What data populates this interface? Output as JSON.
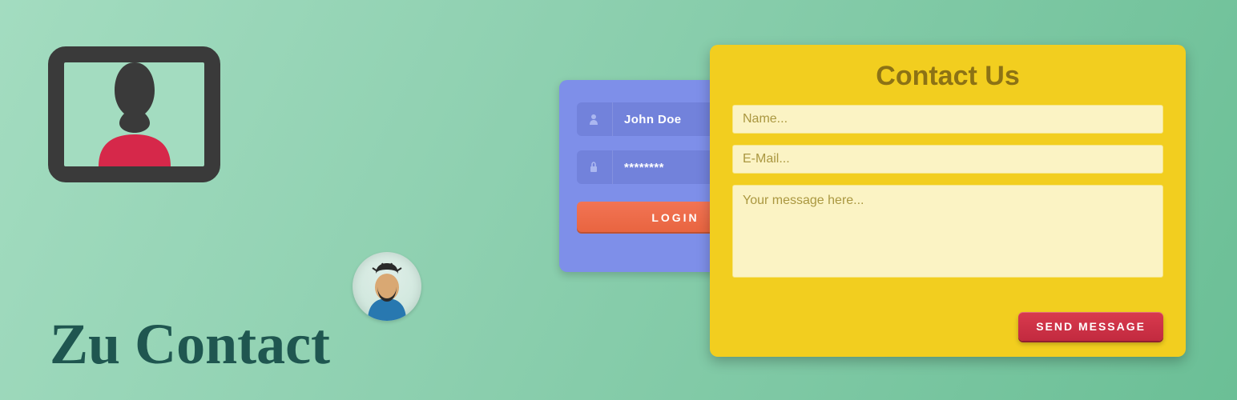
{
  "brand": {
    "title": "Zu Contact"
  },
  "login": {
    "username": "John Doe",
    "password": "********",
    "button": "LOGIN"
  },
  "contact": {
    "title": "Contact Us",
    "name_placeholder": "Name...",
    "email_placeholder": "E-Mail...",
    "message_placeholder": "Your message here...",
    "send_button": "SEND MESSAGE"
  },
  "colors": {
    "bg_start": "#a3dcc0",
    "bg_end": "#6bbf96",
    "title_color": "#1f5650",
    "login_card": "#7e8fe9",
    "login_field": "#7282db",
    "login_btn": "#e8643f",
    "contact_card": "#f2ce1f",
    "contact_field": "#fbf3c4",
    "send_btn": "#c22a3f"
  }
}
